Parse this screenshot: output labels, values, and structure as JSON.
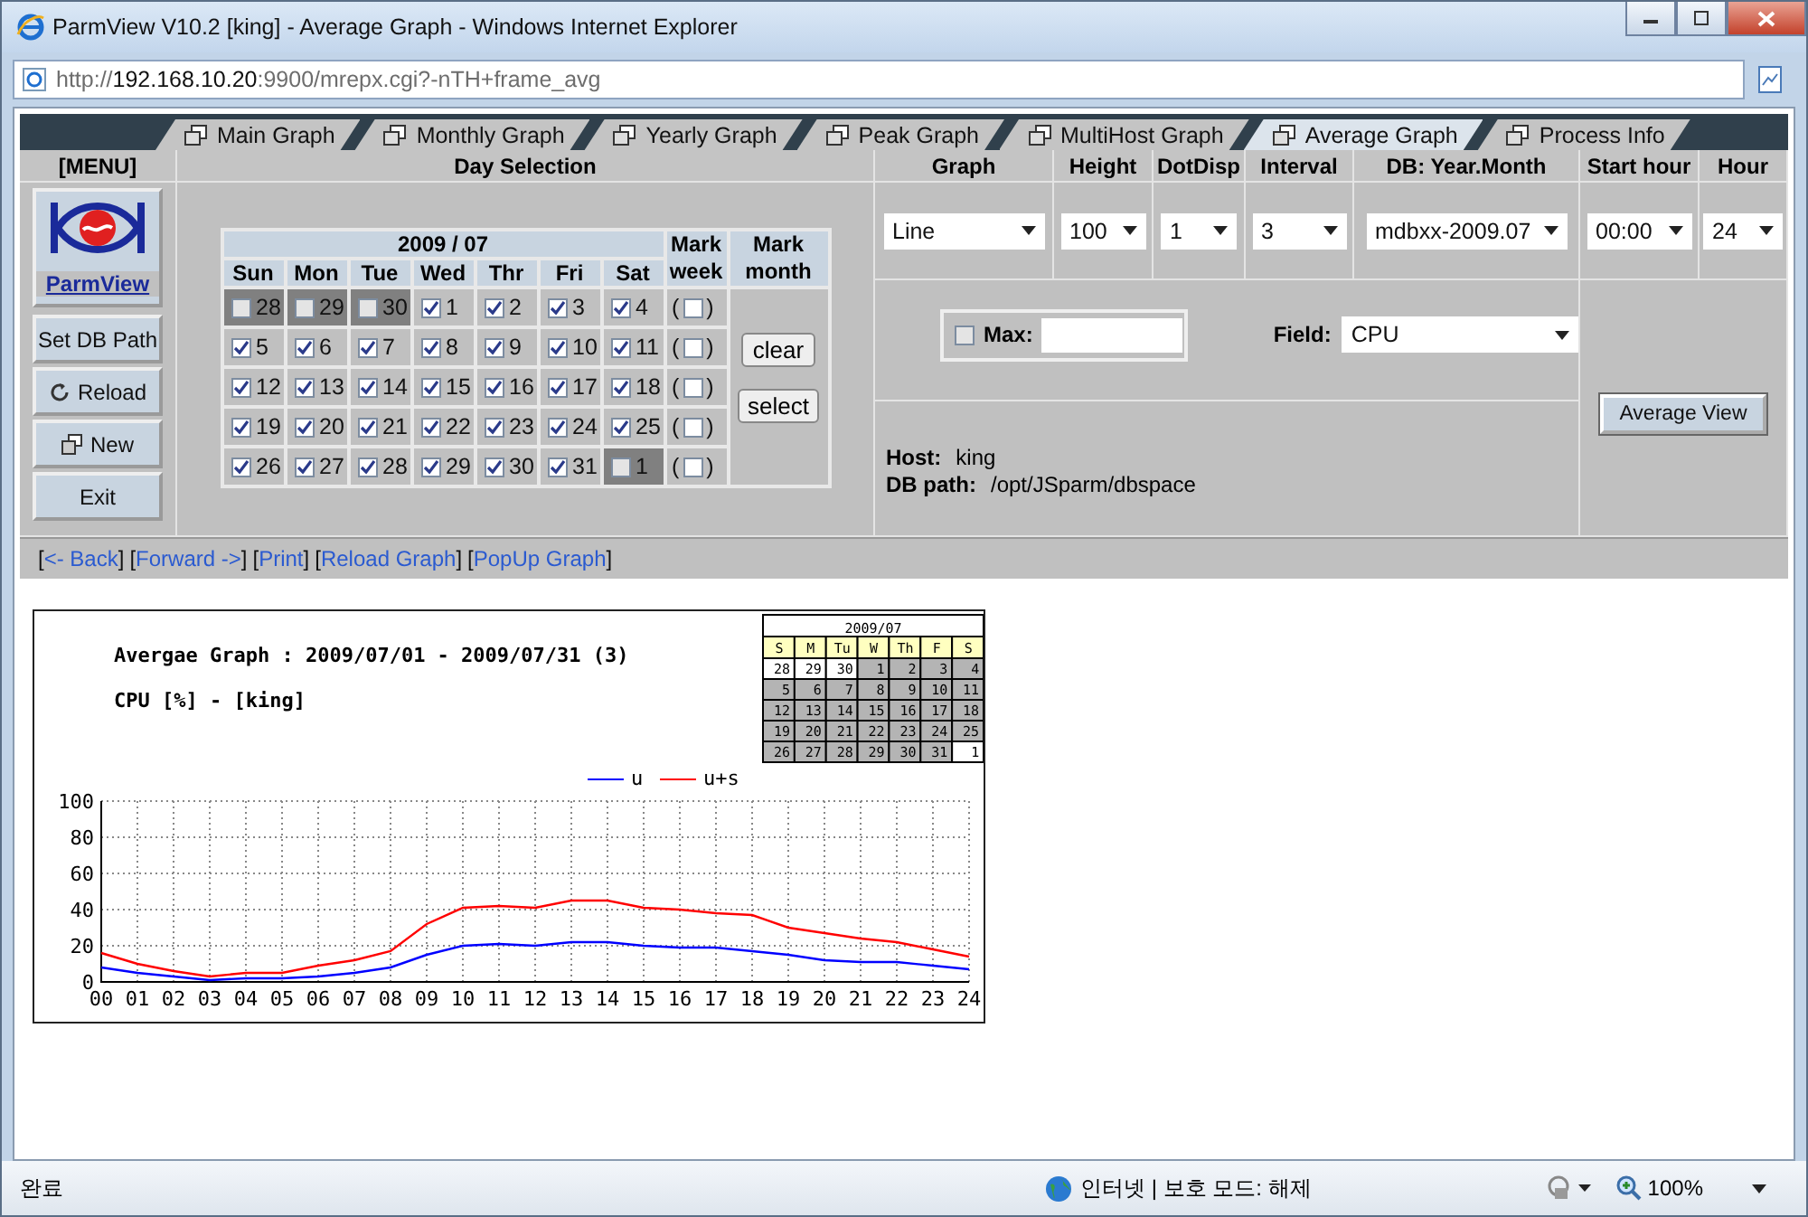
{
  "window": {
    "title": "ParmView V10.2 [king] - Average Graph - Windows Internet Explorer"
  },
  "address_bar": {
    "scheme": "http://",
    "host": "192.168.10.20",
    "rest": ":9900/mrepx.cgi?-nTH+frame_avg"
  },
  "tabs": [
    {
      "label": "Main Graph",
      "selected": false
    },
    {
      "label": "Monthly Graph",
      "selected": false
    },
    {
      "label": "Yearly Graph",
      "selected": false
    },
    {
      "label": "Peak Graph",
      "selected": false
    },
    {
      "label": "MultiHost Graph",
      "selected": false
    },
    {
      "label": "Average Graph",
      "selected": true
    },
    {
      "label": "Process Info",
      "selected": false
    }
  ],
  "menu": {
    "heading": "[MENU]",
    "logo_label": "ParmView",
    "buttons": [
      {
        "label": "Set DB Path",
        "kind": "plain"
      },
      {
        "label": "Reload",
        "kind": "reload"
      },
      {
        "label": "New",
        "kind": "new"
      },
      {
        "label": "Exit",
        "kind": "plain"
      }
    ]
  },
  "day_selection": {
    "heading": "Day Selection",
    "month": "2009 / 07",
    "weekdays": [
      "Sun",
      "Mon",
      "Tue",
      "Wed",
      "Thr",
      "Fri",
      "Sat"
    ],
    "mark_week_heading": "Mark week",
    "mark_month_heading": "Mark month",
    "open": "(",
    "close": ")",
    "month_buttons": [
      "clear",
      "select"
    ],
    "weeks": [
      {
        "mark_week_checked": false,
        "days": [
          {
            "day": "28",
            "checked": false,
            "kind": "adjacent"
          },
          {
            "day": "29",
            "checked": false,
            "kind": "adjacent"
          },
          {
            "day": "30",
            "checked": false,
            "kind": "adjacent"
          },
          {
            "day": "1",
            "checked": true,
            "kind": "current"
          },
          {
            "day": "2",
            "checked": true,
            "kind": "current"
          },
          {
            "day": "3",
            "checked": true,
            "kind": "current"
          },
          {
            "day": "4",
            "checked": true,
            "kind": "current"
          }
        ]
      },
      {
        "mark_week_checked": false,
        "days": [
          {
            "day": "5",
            "checked": true,
            "kind": "current"
          },
          {
            "day": "6",
            "checked": true,
            "kind": "current"
          },
          {
            "day": "7",
            "checked": true,
            "kind": "current"
          },
          {
            "day": "8",
            "checked": true,
            "kind": "current"
          },
          {
            "day": "9",
            "checked": true,
            "kind": "current"
          },
          {
            "day": "10",
            "checked": true,
            "kind": "current"
          },
          {
            "day": "11",
            "checked": true,
            "kind": "current"
          }
        ]
      },
      {
        "mark_week_checked": false,
        "days": [
          {
            "day": "12",
            "checked": true,
            "kind": "current"
          },
          {
            "day": "13",
            "checked": true,
            "kind": "current"
          },
          {
            "day": "14",
            "checked": true,
            "kind": "current"
          },
          {
            "day": "15",
            "checked": true,
            "kind": "current"
          },
          {
            "day": "16",
            "checked": true,
            "kind": "current"
          },
          {
            "day": "17",
            "checked": true,
            "kind": "current"
          },
          {
            "day": "18",
            "checked": true,
            "kind": "current"
          }
        ]
      },
      {
        "mark_week_checked": false,
        "days": [
          {
            "day": "19",
            "checked": true,
            "kind": "current"
          },
          {
            "day": "20",
            "checked": true,
            "kind": "current"
          },
          {
            "day": "21",
            "checked": true,
            "kind": "current"
          },
          {
            "day": "22",
            "checked": true,
            "kind": "current"
          },
          {
            "day": "23",
            "checked": true,
            "kind": "current"
          },
          {
            "day": "24",
            "checked": true,
            "kind": "current"
          },
          {
            "day": "25",
            "checked": true,
            "kind": "current"
          }
        ]
      },
      {
        "mark_week_checked": false,
        "days": [
          {
            "day": "26",
            "checked": true,
            "kind": "current"
          },
          {
            "day": "27",
            "checked": true,
            "kind": "current"
          },
          {
            "day": "28",
            "checked": true,
            "kind": "current"
          },
          {
            "day": "29",
            "checked": true,
            "kind": "current"
          },
          {
            "day": "30",
            "checked": true,
            "kind": "current"
          },
          {
            "day": "31",
            "checked": true,
            "kind": "current"
          },
          {
            "day": "1",
            "checked": false,
            "kind": "adjacent"
          }
        ]
      }
    ]
  },
  "options": [
    {
      "label": "Graph",
      "value": "Line"
    },
    {
      "label": "Height",
      "value": "100"
    },
    {
      "label": "DotDisp",
      "value": "1"
    },
    {
      "label": "Interval",
      "value": "3"
    },
    {
      "label": "DB: Year.Month",
      "value": "mdbxx-2009.07"
    },
    {
      "label": "Start hour",
      "value": "00:00"
    },
    {
      "label": "Hour",
      "value": "24"
    }
  ],
  "max": {
    "label": "Max:",
    "checked": false
  },
  "field": {
    "label": "Field:",
    "value": "CPU"
  },
  "host": {
    "label": "Host:",
    "value": "king"
  },
  "db_path": {
    "label": "DB path:",
    "value": "/opt/JSparm/dbspace"
  },
  "average_button": "Average View",
  "nav_links": [
    {
      "open": "[",
      "label": "<- Back",
      "close": "]"
    },
    {
      "open": "[",
      "label": "Forward ->",
      "close": "]"
    },
    {
      "open": "[",
      "label": "Print",
      "close": "]"
    },
    {
      "open": "[",
      "label": "Reload Graph",
      "close": "]"
    },
    {
      "open": "[",
      "label": "PopUp Graph",
      "close": "]"
    }
  ],
  "graph": {
    "title": "Avergae Graph : 2009/07/01 - 2009/07/31 (3)",
    "subtitle": "CPU [%] - [king]",
    "mini_calendar": {
      "title": "2009/07",
      "weekdays": [
        "S",
        "M",
        "Tu",
        "W",
        "Th",
        "F",
        "S"
      ],
      "weeks": [
        [
          {
            "day": "28",
            "selected": false
          },
          {
            "day": "29",
            "selected": false
          },
          {
            "day": "30",
            "selected": false
          },
          {
            "day": "1",
            "selected": true
          },
          {
            "day": "2",
            "selected": true
          },
          {
            "day": "3",
            "selected": true
          },
          {
            "day": "4",
            "selected": true
          }
        ],
        [
          {
            "day": "5",
            "selected": true
          },
          {
            "day": "6",
            "selected": true
          },
          {
            "day": "7",
            "selected": true
          },
          {
            "day": "8",
            "selected": true
          },
          {
            "day": "9",
            "selected": true
          },
          {
            "day": "10",
            "selected": true
          },
          {
            "day": "11",
            "selected": true
          }
        ],
        [
          {
            "day": "12",
            "selected": true
          },
          {
            "day": "13",
            "selected": true
          },
          {
            "day": "14",
            "selected": true
          },
          {
            "day": "15",
            "selected": true
          },
          {
            "day": "16",
            "selected": true
          },
          {
            "day": "17",
            "selected": true
          },
          {
            "day": "18",
            "selected": true
          }
        ],
        [
          {
            "day": "19",
            "selected": true
          },
          {
            "day": "20",
            "selected": true
          },
          {
            "day": "21",
            "selected": true
          },
          {
            "day": "22",
            "selected": true
          },
          {
            "day": "23",
            "selected": true
          },
          {
            "day": "24",
            "selected": true
          },
          {
            "day": "25",
            "selected": true
          }
        ],
        [
          {
            "day": "26",
            "selected": true
          },
          {
            "day": "27",
            "selected": true
          },
          {
            "day": "28",
            "selected": true
          },
          {
            "day": "29",
            "selected": true
          },
          {
            "day": "30",
            "selected": true
          },
          {
            "day": "31",
            "selected": true
          },
          {
            "day": "1",
            "selected": false
          }
        ]
      ]
    },
    "chart_data": {
      "type": "line",
      "x": [
        "00",
        "01",
        "02",
        "03",
        "04",
        "05",
        "06",
        "07",
        "08",
        "09",
        "10",
        "11",
        "12",
        "13",
        "14",
        "15",
        "16",
        "17",
        "18",
        "19",
        "20",
        "21",
        "22",
        "23",
        "24"
      ],
      "series": [
        {
          "name": "u",
          "color": "#0000ff",
          "values": [
            8,
            5,
            3,
            1,
            2,
            2,
            3,
            5,
            8,
            15,
            20,
            21,
            20,
            22,
            22,
            20,
            19,
            19,
            17,
            15,
            12,
            11,
            11,
            9,
            7
          ]
        },
        {
          "name": "u+s",
          "color": "#ff0000",
          "values": [
            16,
            10,
            6,
            3,
            5,
            5,
            9,
            12,
            17,
            32,
            41,
            42,
            41,
            45,
            45,
            41,
            40,
            38,
            37,
            30,
            27,
            24,
            22,
            18,
            14
          ]
        }
      ],
      "ylim": [
        0,
        100
      ],
      "yticks": [
        0,
        20,
        40,
        60,
        80,
        100
      ],
      "grid": true,
      "legend": true
    }
  },
  "status_bar": {
    "status": "완료",
    "zone": "인터넷 | 보호 모드: 해제",
    "zoom": "100%"
  }
}
